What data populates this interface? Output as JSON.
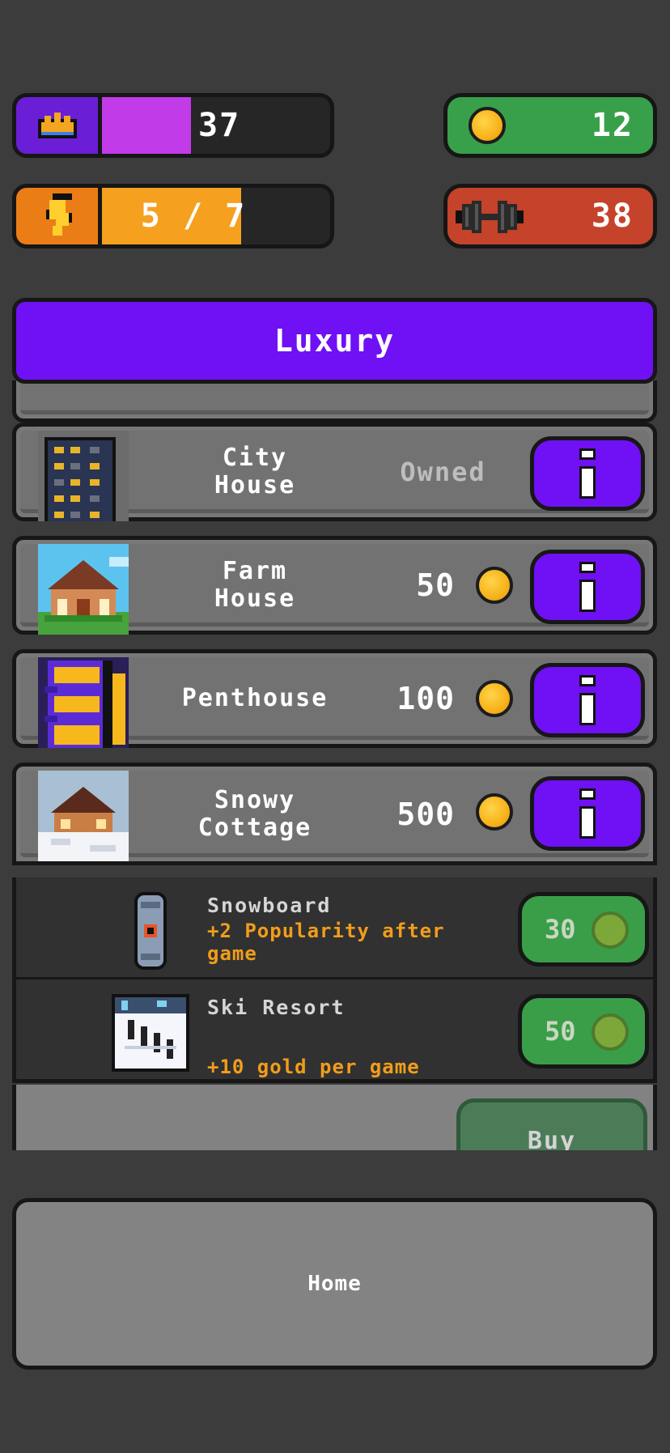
{
  "stats": {
    "popularity": {
      "value": "37",
      "fill_fraction": 0.39,
      "icon": "crown-icon"
    },
    "energy": {
      "value": "5 / 7",
      "fill_fraction": 0.61,
      "icon": "lightning-icon"
    },
    "gold": {
      "value": "12",
      "icon": "coin-icon"
    },
    "strength": {
      "value": "38",
      "icon": "dumbbell-icon"
    }
  },
  "category": {
    "label": "Luxury"
  },
  "houses": [
    {
      "name": "City\nHouse",
      "status": "Owned",
      "icon": "city-house-icon"
    },
    {
      "name": "Farm\nHouse",
      "price": "50",
      "icon": "farm-house-icon"
    },
    {
      "name": "Penthouse",
      "price": "100",
      "icon": "penthouse-icon"
    },
    {
      "name": "Snowy\nCottage",
      "price": "500",
      "icon": "snowy-cottage-icon"
    }
  ],
  "items": [
    {
      "name": "Snowboard",
      "description": "+2 Popularity after game",
      "price": "30",
      "icon": "snowboard-icon"
    },
    {
      "name": "Ski Resort",
      "description": "+10 gold per game",
      "price": "50",
      "icon": "ski-resort-icon"
    }
  ],
  "buy_button": {
    "label": "Buy"
  },
  "home_button": {
    "label": "Home"
  },
  "colors": {
    "background": "#3c3c3c",
    "purple": "#7010f5",
    "green": "#38a04a",
    "orange": "#f5a01e",
    "red": "#c4432a"
  }
}
